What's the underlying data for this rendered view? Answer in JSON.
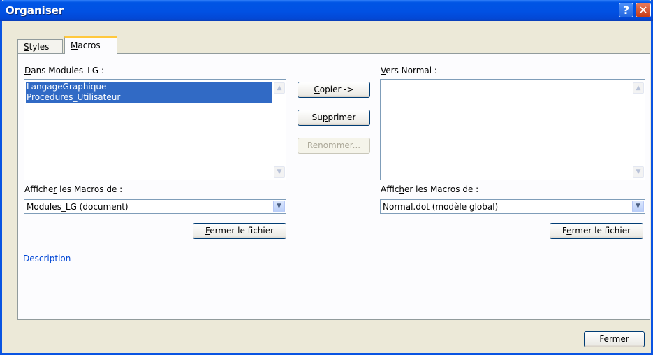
{
  "window": {
    "title": "Organiser",
    "help_glyph": "?",
    "close_glyph": "✕"
  },
  "tabs": [
    {
      "label": "Styles",
      "mnemonic": "S",
      "rest": "tyles",
      "active": false
    },
    {
      "label": "Macros",
      "mnemonic": "M",
      "rest": "acros",
      "active": true
    }
  ],
  "left": {
    "list_label_pre": "",
    "list_label_mn": "D",
    "list_label_post": "ans Modules_LG :",
    "items": [
      "LangageGraphique",
      "Procedures_Utilisateur"
    ],
    "show_label_pre": "Affiche",
    "show_label_mn": "r",
    "show_label_post": " les Macros de :",
    "combo_value": "Modules_LG (document)",
    "close_pre": "",
    "close_mn": "F",
    "close_post": "ermer le fichier"
  },
  "right": {
    "list_label_pre": "",
    "list_label_mn": "V",
    "list_label_post": "ers Normal :",
    "items": [],
    "show_label_pre": "Affic",
    "show_label_mn": "h",
    "show_label_post": "er les Macros de :",
    "combo_value": "Normal.dot (modèle global)",
    "close_pre": "F",
    "close_mn": "e",
    "close_post": "rmer le fichier"
  },
  "middle": {
    "copy_pre": "",
    "copy_mn": "C",
    "copy_post": "opier ->",
    "delete_pre": "Su",
    "delete_mn": "p",
    "delete_post": "primer",
    "rename": "Renommer..."
  },
  "description": {
    "label": "Description"
  },
  "footer": {
    "close_label": "Fermer"
  },
  "icons": {
    "scroll_up": "▲",
    "scroll_down": "▼",
    "dropdown": "▼"
  },
  "colors": {
    "title_bar": "#0055e5",
    "selection": "#316ac5",
    "description": "#0046d5",
    "tab_highlight": "#ffc83c"
  }
}
